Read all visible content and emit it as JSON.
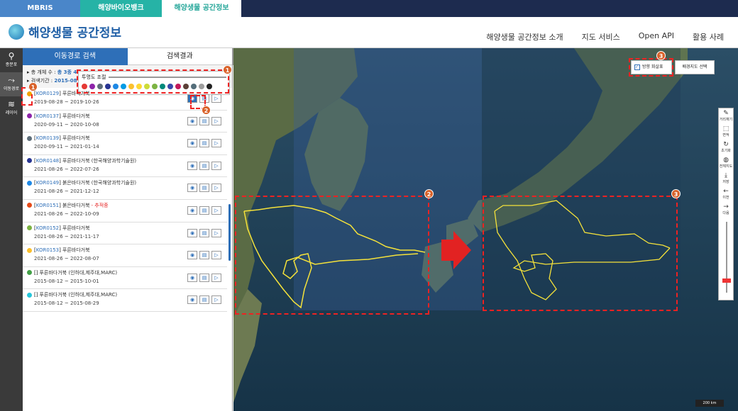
{
  "top_tabs": [
    "MBRIS",
    "해양바이오뱅크",
    "해양생물 공간정보"
  ],
  "logo_text": "해양생물 공간정보",
  "gnb": [
    "해양생물 공간정보 소개",
    "지도 서비스",
    "Open API",
    "활용 사례"
  ],
  "rail": [
    {
      "label": "종분포",
      "icon": "map-pin"
    },
    {
      "label": "이동경로",
      "icon": "route"
    },
    {
      "label": "레이어",
      "icon": "layers"
    }
  ],
  "panel": {
    "tabs": [
      "이동경로 검색",
      "검색결과"
    ],
    "summary_total": "총 개체 수 :",
    "summary_total_value": "총 3종 4",
    "summary_period": "검색기간 :",
    "summary_period_value": "2015-08",
    "opacity_label": "투명도 조절",
    "palette": [
      "#e53935",
      "#8e24aa",
      "#5e6e7a",
      "#283593",
      "#1e88e5",
      "#039be5",
      "#fbc02d",
      "#fdd835",
      "#cddc39",
      "#7cb342",
      "#00897b",
      "#3949ab",
      "#c2185b",
      "#5d4037",
      "#546e7a",
      "#9e9e9e",
      "#212121",
      "#26c6da",
      "#43a047",
      "#8d6e63",
      "#000000"
    ]
  },
  "results": [
    {
      "color": "#f4a300",
      "id": "KOR0129",
      "name": "푸른바다거북",
      "status": "",
      "period": "2019-08-28 ~ 2019-10-26"
    },
    {
      "color": "#8e24aa",
      "id": "KOR0137",
      "name": "푸른바다거북",
      "status": "",
      "period": "2020-09-11 ~ 2020-10-08"
    },
    {
      "color": "#5e6e7a",
      "id": "KOR0139",
      "name": "푸른바다거북",
      "status": "",
      "period": "2020-09-11 ~ 2021-01-14"
    },
    {
      "color": "#283593",
      "id": "KOR0148",
      "name": "푸른바다거북 (한국해양과학기술원)",
      "status": "",
      "period": "2021-08-26 ~ 2022-07-26"
    },
    {
      "color": "#1e88e5",
      "id": "KOR0149",
      "name": "붉은바다거북 (한국해양과학기술원)",
      "status": "",
      "period": "2021-08-26 ~ 2021-12-12"
    },
    {
      "color": "#e64a19",
      "id": "KOR0151",
      "name": "붉은바다거북",
      "status": "- 추적중",
      "period": "2021-08-26 ~ 2022-10-09"
    },
    {
      "color": "#7cb342",
      "id": "KOR0152",
      "name": "푸른바다거북",
      "status": "",
      "period": "2021-08-26 ~ 2021-11-17"
    },
    {
      "color": "#fbc02d",
      "id": "KOR0153",
      "name": "푸른바다거북",
      "status": "",
      "period": "2021-08-26 ~ 2022-08-07"
    },
    {
      "color": "#43a047",
      "id": "",
      "name": "푸른바다거북 (인하대,제주대,MARC)",
      "status": "",
      "period": "2015-08-12 ~ 2015-10-01"
    },
    {
      "color": "#26c6da",
      "id": "",
      "name": "푸른바다거북 (인하대,제주대,MARC)",
      "status": "",
      "period": "2015-08-12 ~ 2015-08-29"
    }
  ],
  "map": {
    "arrow_label": "방향 화살표",
    "basemap_label": "배경지도 선택",
    "scale_label": "200 km",
    "tools": [
      "거리재기",
      "면적",
      "초기화",
      "전체지도",
      "저장",
      "이전",
      "다음"
    ],
    "callouts": [
      "1",
      "2",
      "3"
    ]
  },
  "colors": {
    "accent": "#2e6fb8",
    "callout": "#d9622a",
    "highlight": "#e22222",
    "track": "#f5e23a"
  }
}
